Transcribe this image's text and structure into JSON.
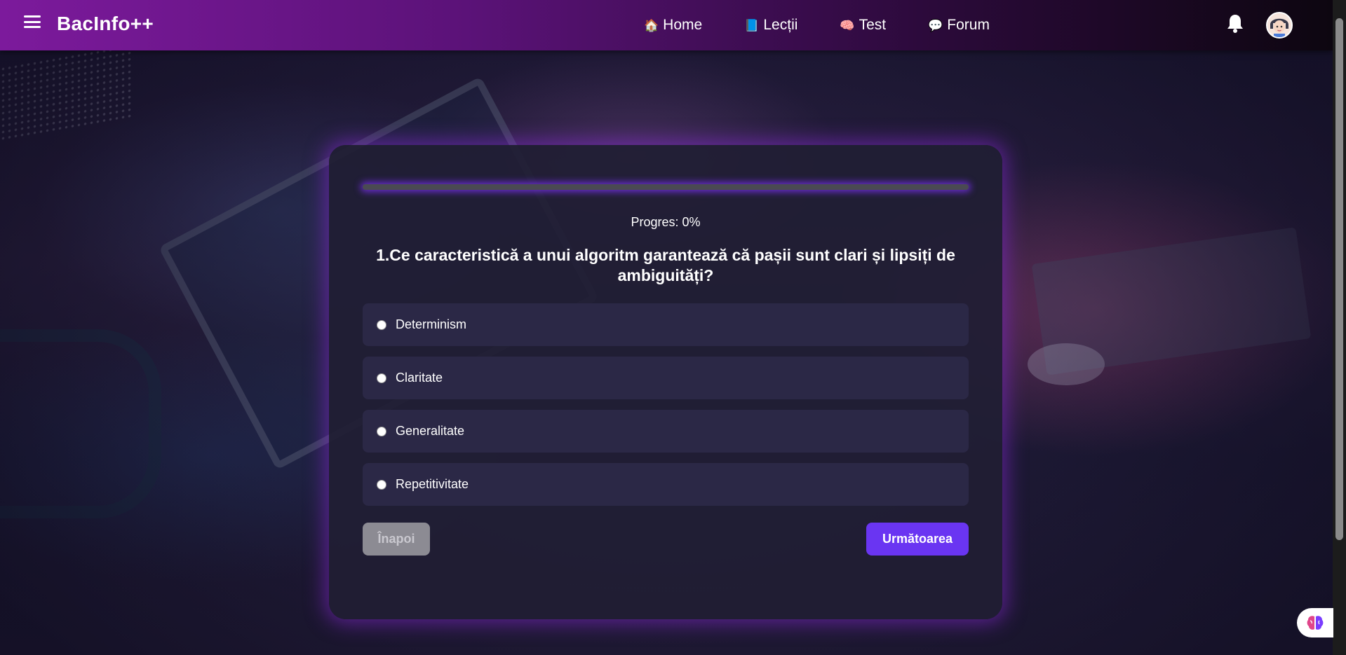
{
  "navbar": {
    "brand": "BacInfo++",
    "links": [
      {
        "icon": "house-icon",
        "glyph": "🏠",
        "label": "Home"
      },
      {
        "icon": "book-icon",
        "glyph": "📘",
        "label": "Lecții"
      },
      {
        "icon": "brain-icon",
        "glyph": "🧠",
        "label": "Test"
      },
      {
        "icon": "speech-bubble-icon",
        "glyph": "💬",
        "label": "Forum"
      }
    ]
  },
  "quiz": {
    "progress_text": "Progres: 0%",
    "progress_value": 0,
    "question": "1.Ce caracteristică a unui algoritm garantează că pașii sunt clari și lipsiți de ambiguități?",
    "options": [
      {
        "label": "Determinism",
        "selected": false
      },
      {
        "label": "Claritate",
        "selected": false
      },
      {
        "label": "Generalitate",
        "selected": false
      },
      {
        "label": "Repetitivitate",
        "selected": false
      }
    ],
    "back_label": "Înapoi",
    "back_disabled": true,
    "next_label": "Următoarea"
  },
  "colors": {
    "accent": "#6a35f2",
    "nav_start": "#7c1a9c",
    "card_glow": "#8c28dc"
  }
}
